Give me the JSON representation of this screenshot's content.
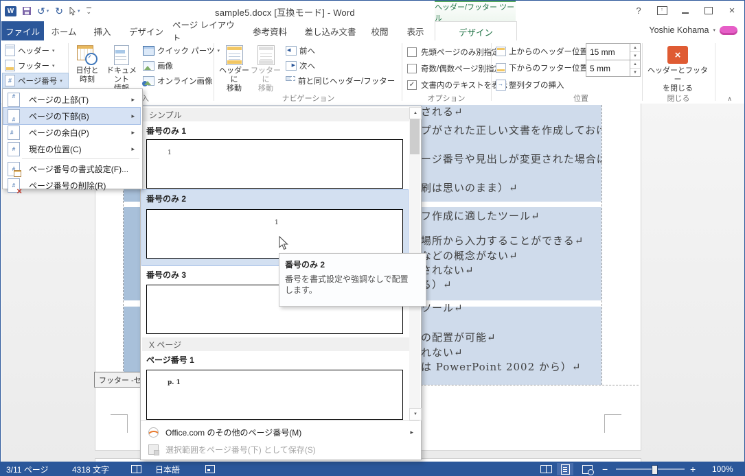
{
  "titlebar": {
    "title": "sample5.docx [互換モード] - Word",
    "contextual_tool": "ヘッダー/フッター ツール",
    "user_name": "Yoshie Kohama"
  },
  "tabs": {
    "file": "ファイル",
    "home": "ホーム",
    "insert": "挿入",
    "design": "デザイン",
    "layout": "ページ レイアウト",
    "references": "参考資料",
    "mailings": "差し込み文書",
    "review": "校閲",
    "view": "表示",
    "hf_design": "デザイン"
  },
  "ribbon": {
    "hf": {
      "header": "ヘッダー",
      "footer": "フッター",
      "page_number": "ページ番号"
    },
    "insert": {
      "label": "挿入",
      "date_l1": "日付と",
      "date_l2": "時刻",
      "docinfo_l1": "ドキュメント",
      "docinfo_l2": "情報",
      "quick_parts": "クイック パーツ",
      "pictures": "画像",
      "online_pictures": "オンライン画像"
    },
    "nav": {
      "label": "ナビゲーション",
      "goto_header_l1": "ヘッダーに",
      "goto_header_l2": "移動",
      "goto_footer_l1": "フッターに",
      "goto_footer_l2": "移動",
      "prev": "前へ",
      "next": "次へ",
      "link_prev": "前と同じヘッダー/フッター"
    },
    "options": {
      "label": "オプション",
      "cb_first": "先頭ページのみ別指定",
      "cb_oddeven": "奇数/偶数ページ別指定",
      "cb_showtext": "文書内のテキストを表示"
    },
    "position": {
      "label": "位置",
      "header_pos": "上からのヘッダー位置:",
      "header_val": "15 mm",
      "footer_pos": "下からのフッター位置:",
      "footer_val": "5 mm",
      "align_tab": "整列タブの挿入"
    },
    "close": {
      "label": "閉じる",
      "btn_l1": "ヘッダーとフッター",
      "btn_l2": "を閉じる"
    }
  },
  "menu": {
    "items": [
      {
        "label": "ページの上部(T)"
      },
      {
        "label": "ページの下部(B)"
      },
      {
        "label": "ページの余白(P)"
      },
      {
        "label": "現在の位置(C)"
      },
      {
        "label": "ページ番号の書式設定(F)..."
      },
      {
        "label": "ページ番号の削除(R)"
      }
    ]
  },
  "gallery": {
    "section_simple": "シンプル",
    "section_xpage": "X ページ",
    "item1": "番号のみ 1",
    "preview1": "1",
    "item2": "番号のみ 2",
    "preview2": "1",
    "item3": "番号のみ 3",
    "item4": "ページ番号 1",
    "preview4": "p. 1",
    "footer_more": "Office.com のその他のページ番号(M)",
    "footer_save": "選択範囲をページ番号(下) として保存(S)"
  },
  "tooltip": {
    "title": "番号のみ 2",
    "body": "番号を書式設定や強調なしで配置します。"
  },
  "document": {
    "footer_tag": "フッター -セ",
    "lines": [
      "される↵",
      "プがされた正しい文書を作成しておけ",
      "ージ番号や見出しが変更された場合は、",
      "刷は思いのまま）↵",
      "フ作成に適したツール↵",
      "場所から入力することができる↵",
      "などの概念がない↵",
      "されない↵",
      "る）↵",
      "ツール↵",
      "の配置が可能↵",
      "れない↵",
      "は PowerPoint 2002 から）↵"
    ]
  },
  "statusbar": {
    "page": "3/11 ページ",
    "words": "4318 文字",
    "language": "日本語",
    "zoom": "100%"
  },
  "icons": {
    "dropdown": "▾",
    "submenu_arrow": "▸",
    "spin_up": "▲",
    "spin_down": "▼",
    "scroll_up": "▲",
    "scroll_down": "▼",
    "check": "✓",
    "help": "?",
    "close": "×",
    "undo": "↺",
    "redo": "↻",
    "collapse": "∧",
    "minus": "−",
    "plus": "+",
    "more": "⌄"
  },
  "colors": {
    "accent": "#2b579a",
    "contextual_green": "#217346",
    "close_red": "#df5b33",
    "selection": "#cfdbeb"
  }
}
